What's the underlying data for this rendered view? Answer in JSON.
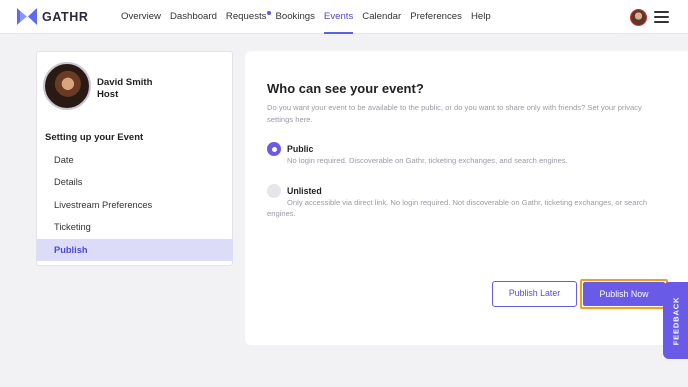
{
  "header": {
    "brand": "GATHR",
    "logo_icon": "gathr-logo-icon",
    "nav": [
      {
        "label": "Overview",
        "active": false
      },
      {
        "label": "Dashboard",
        "active": false
      },
      {
        "label": "Requests",
        "active": false,
        "badge_dot": true
      },
      {
        "label": "Bookings",
        "active": false
      },
      {
        "label": "Events",
        "active": true
      },
      {
        "label": "Calendar",
        "active": false
      },
      {
        "label": "Preferences",
        "active": false
      },
      {
        "label": "Help",
        "active": false
      }
    ],
    "avatar_icon": "user-avatar",
    "menu_icon": "hamburger-menu-icon"
  },
  "sidebar": {
    "user_name": "David Smith",
    "user_role": "Host",
    "section_title": "Setting up your Event",
    "steps": [
      {
        "label": "Date",
        "active": false
      },
      {
        "label": "Details",
        "active": false
      },
      {
        "label": "Livestream Preferences",
        "active": false
      },
      {
        "label": "Ticketing",
        "active": false
      },
      {
        "label": "Publish",
        "active": true
      }
    ]
  },
  "main": {
    "title": "Who can see your event?",
    "description": "Do you want your event to be available to the public, or do you want to share only with friends? Set your privacy settings here.",
    "options": [
      {
        "title": "Public",
        "description": "No login required. Discoverable on Gathr, ticketing exchanges, and search engines.",
        "selected": true
      },
      {
        "title": "Unlisted",
        "description": "Only accessible via direct link. No login required. Not discoverable on Gathr, ticketing exchanges, or search engines.",
        "selected": false
      }
    ],
    "publish_later_label": "Publish Later",
    "publish_now_label": "Publish Now"
  },
  "feedback_label": "FEEDBACK",
  "colors": {
    "accent": "#6a5ae8",
    "active_step_bg": "#dcdcf8",
    "highlight_outline": "#f0a020",
    "page_bg": "#f2f2f4"
  }
}
